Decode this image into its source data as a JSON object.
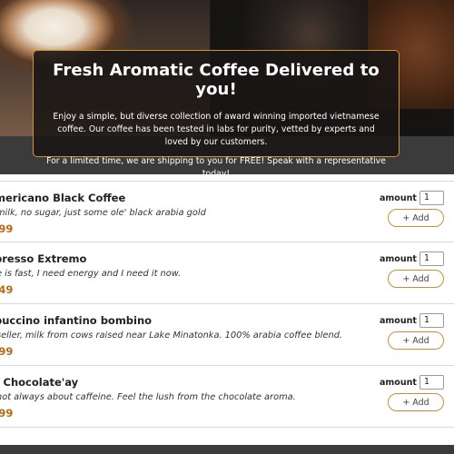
{
  "banner": {
    "title": "Fresh Aromatic Coffee Delivered to you!",
    "paragraph1": "Enjoy a simple, but diverse collection of award winning imported vietnamese coffee. Our coffee has been tested in labs for purity, vetted by experts and loved by our customers.",
    "paragraph2": "For a limited time, we are shipping to you for FREE! Speak with a representative today!"
  },
  "menu": {
    "items": [
      {
        "name": "mericano Black Coffee",
        "description": "milk, no sugar, just some ole' black arabia gold",
        "price": ".99",
        "amount_label": "amount",
        "amount_value": "1",
        "add_label": "+ Add"
      },
      {
        "name": "presso Extremo",
        "description": "e is fast, I need energy and I need it now.",
        "price": ".49",
        "amount_label": "amount",
        "amount_value": "1",
        "add_label": "+ Add"
      },
      {
        "name": "puccino infantino bombino",
        "description": "seller, milk from cows raised near Lake Minatonka. 100% arabia coffee blend.",
        "price": ".99",
        "amount_label": "amount",
        "amount_value": "1",
        "add_label": "+ Add"
      },
      {
        "name": "t Chocolate'ay",
        "description": "not always about caffeine. Feel the lush from the chocolate aroma.",
        "price": ".99",
        "amount_label": "amount",
        "amount_value": "1",
        "add_label": "+ Add"
      }
    ]
  },
  "colors": {
    "accent": "#c49234",
    "price": "#b86b14",
    "banner_bg": "#191614",
    "band": "#3b3b3b"
  }
}
